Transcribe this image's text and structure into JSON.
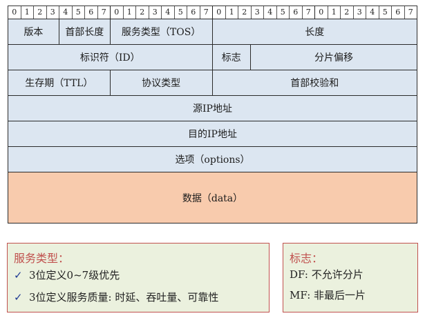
{
  "bit_labels": [
    "0",
    "1",
    "2",
    "3",
    "4",
    "5",
    "6",
    "7",
    "0",
    "1",
    "2",
    "3",
    "4",
    "5",
    "6",
    "7",
    "0",
    "1",
    "2",
    "3",
    "4",
    "5",
    "6",
    "7",
    "0",
    "1",
    "2",
    "3",
    "4",
    "5",
    "6",
    "7"
  ],
  "rows": [
    [
      {
        "label": "版本",
        "bits": 4
      },
      {
        "label": "首部长度",
        "bits": 4
      },
      {
        "label": "服务类型（TOS）",
        "bits": 8
      },
      {
        "label": "长度",
        "bits": 16
      }
    ],
    [
      {
        "label": "标识符（ID）",
        "bits": 16
      },
      {
        "label": "标志",
        "bits": 3
      },
      {
        "label": "分片偏移",
        "bits": 13
      }
    ],
    [
      {
        "label": "生存期（TTL）",
        "bits": 8
      },
      {
        "label": "协议类型",
        "bits": 8
      },
      {
        "label": "首部校验和",
        "bits": 16
      }
    ],
    [
      {
        "label": "源IP地址",
        "bits": 32
      }
    ],
    [
      {
        "label": "目的IP地址",
        "bits": 32
      }
    ],
    [
      {
        "label": "选项（options）",
        "bits": 32
      }
    ]
  ],
  "data_row": {
    "label": "数据（data）"
  },
  "tos_note": {
    "title": "服务类型：",
    "items": [
      "3位定义0~7级优先",
      "3位定义服务质量: 时延、吞吐量、可靠性"
    ],
    "bullet": "✓"
  },
  "flag_note": {
    "title": "标志：",
    "items": [
      "DF: 不允许分片",
      "MF: 非最后一片"
    ]
  },
  "colors": {
    "header_fill": "#dce6f1",
    "data_fill": "#f8cbad",
    "note_fill": "#ebf1de",
    "note_border": "#c0504d",
    "note_title": "#c0504d"
  }
}
